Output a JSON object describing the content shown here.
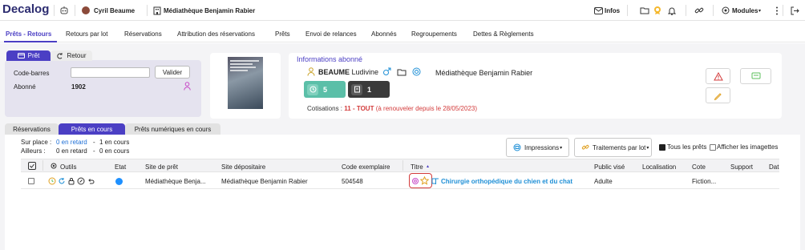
{
  "topbar": {
    "logo": "Decalog",
    "user": "Cyril Beaume",
    "site": "Médiathèque Benjamin Rabier",
    "infos": "Infos",
    "modules": "Modules"
  },
  "nav": [
    "Prêts - Retours",
    "Retours par lot",
    "Réservations",
    "Attribution des réservations",
    "Prêts",
    "Envoi de relances",
    "Abonnés",
    "Regroupements",
    "Dettes & Règlements"
  ],
  "loan_panel": {
    "tab_pret": "Prêt",
    "tab_retour": "Retour",
    "barcode_label": "Code-barres",
    "barcode_value": "",
    "subscriber_label": "Abonné",
    "subscriber_value": "1902",
    "validate": "Valider"
  },
  "subscriber": {
    "title": "Informations abonné",
    "last_name": "BEAUME",
    "first_name": "Ludivine",
    "library": "Médiathèque Benjamin Rabier",
    "loans_count": "5",
    "other_count": "1",
    "cotisations_label": "Cotisations :",
    "cotisations_value": "11 - TOUT",
    "cotisations_note": "(à renouveler depuis le 28/05/2023)"
  },
  "sub_tabs": [
    "Réservations",
    "Prêts en cours",
    "Prêts numériques en cours"
  ],
  "summary": {
    "sur_place": "Sur place :",
    "sur_place_late": "0 en retard",
    "sur_place_current": "1 en cours",
    "ailleurs": "Ailleurs :",
    "ailleurs_late": "0 en retard",
    "ailleurs_current": "0 en cours",
    "dash": "-"
  },
  "toolbar": {
    "impressions": "Impressions",
    "traitements": "Traitements par lot",
    "tous_les_prets": "Tous les prêts",
    "afficher_imagettes": "Afficher les imagettes"
  },
  "table": {
    "headers": [
      "Outils",
      "Etat",
      "Site de prêt",
      "Site dépositaire",
      "Code exemplaire",
      "Titre",
      "Public visé",
      "Localisation",
      "Cote",
      "Support",
      "Dat"
    ],
    "sort_indicator": "▴",
    "row": {
      "site_pret": "Médiathèque Benja...",
      "site_depositaire": "Médiathèque Benjamin Rabier",
      "code": "504548",
      "titre": "Chirurgie orthopédique du chien et du chat",
      "public": "Adulte",
      "localisation": "",
      "cote": "Fiction...",
      "etat_color": "#1e90ff"
    }
  },
  "colors": {
    "accent": "#4b3fc4",
    "green": "#5bbfa8",
    "dark": "#3a3a3a",
    "red": "#d33b3b",
    "link": "#1e8fd6"
  }
}
